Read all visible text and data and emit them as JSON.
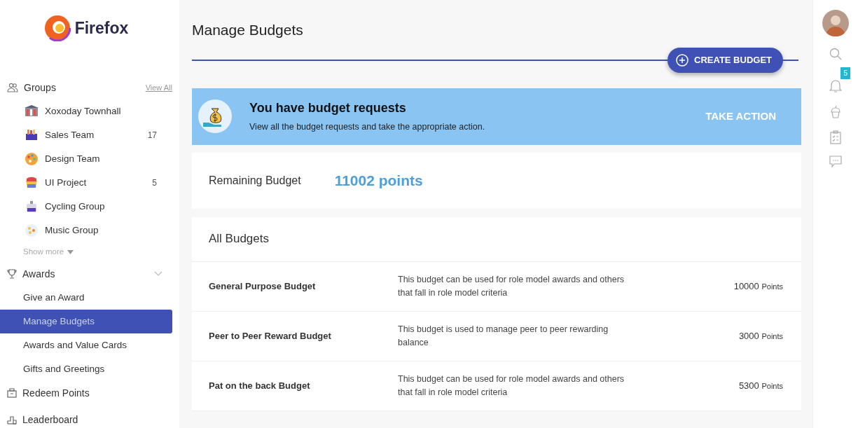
{
  "logo": {
    "text": "Firefox"
  },
  "groups": {
    "label": "Groups",
    "view_all": "View All",
    "show_more": "Show more",
    "items": [
      {
        "name": "Xoxoday Townhall"
      },
      {
        "name": "Sales Team",
        "count": "17"
      },
      {
        "name": "Design Team"
      },
      {
        "name": "UI Project",
        "count": "5"
      },
      {
        "name": "Cycling Group"
      },
      {
        "name": "Music Group"
      }
    ]
  },
  "awards": {
    "label": "Awards",
    "expanded": true,
    "items": [
      {
        "label": "Give an Award",
        "selected": false
      },
      {
        "label": "Manage Budgets",
        "selected": true
      },
      {
        "label": "Awards and Value Cards",
        "selected": false
      },
      {
        "label": "Gifts and Greetings",
        "selected": false
      }
    ]
  },
  "redeem": {
    "label": "Redeem Points"
  },
  "leaderboard": {
    "label": "Leaderboard"
  },
  "page_title": "Manage Budgets",
  "create_button": "CREATE BUDGET",
  "banner": {
    "title": "You have budget requests",
    "text": "View all the budget requests and take the appropriate action.",
    "action": "TAKE ACTION"
  },
  "remaining": {
    "label": "Remaining Budget",
    "value": "11002 points"
  },
  "budgets": {
    "title": "All Budgets",
    "rows": [
      {
        "name": "General Purpose Budget",
        "description": "This budget can be used for role model awards and others that fall in role model criteria",
        "amount": "10000",
        "unit": "Points"
      },
      {
        "name": "Peer to Peer Reward Budget",
        "description": "This budget is used to manage peer to peer rewarding balance",
        "amount": "3000",
        "unit": "Points"
      },
      {
        "name": "Pat on the back Budget",
        "description": "This budget can be used for role model awards and others that fall in role model criteria",
        "amount": "5300",
        "unit": "Points"
      }
    ]
  },
  "notifications": {
    "count": "5"
  }
}
